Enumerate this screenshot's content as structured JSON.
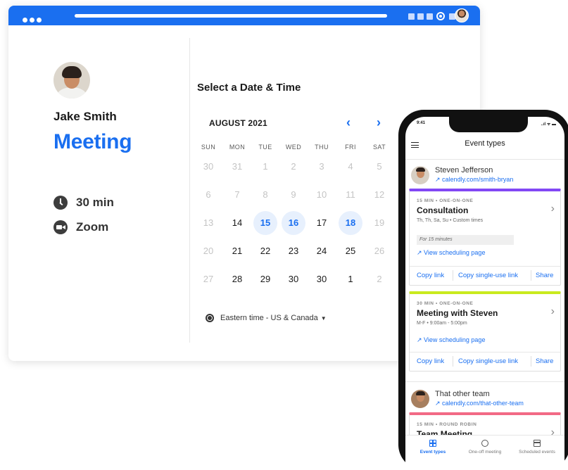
{
  "desktop": {
    "host": {
      "name": "Jake Smith"
    },
    "event": {
      "title": "Meeting",
      "duration": "30 min",
      "location": "Zoom"
    },
    "calendar": {
      "heading": "Select a Date & Time",
      "month_label": "AUGUST 2021",
      "prev_icon": "chevron-left-icon",
      "next_icon": "chevron-right-icon",
      "weekdays": [
        "SUN",
        "MON",
        "TUE",
        "WED",
        "THU",
        "FRI",
        "SAT"
      ],
      "weeks": [
        [
          {
            "d": "30",
            "s": "muted"
          },
          {
            "d": "31",
            "s": "muted"
          },
          {
            "d": "1",
            "s": "muted"
          },
          {
            "d": "2",
            "s": "muted"
          },
          {
            "d": "3",
            "s": "muted"
          },
          {
            "d": "4",
            "s": "muted"
          },
          {
            "d": "5",
            "s": "muted"
          }
        ],
        [
          {
            "d": "6",
            "s": "muted"
          },
          {
            "d": "7",
            "s": "muted"
          },
          {
            "d": "8",
            "s": "muted"
          },
          {
            "d": "9",
            "s": "muted"
          },
          {
            "d": "10",
            "s": "muted"
          },
          {
            "d": "11",
            "s": "muted"
          },
          {
            "d": "12",
            "s": "muted"
          }
        ],
        [
          {
            "d": "13",
            "s": "muted"
          },
          {
            "d": "14",
            "s": "normal"
          },
          {
            "d": "15",
            "s": "avail"
          },
          {
            "d": "16",
            "s": "avail"
          },
          {
            "d": "17",
            "s": "normal"
          },
          {
            "d": "18",
            "s": "avail"
          },
          {
            "d": "19",
            "s": "muted"
          }
        ],
        [
          {
            "d": "20",
            "s": "muted"
          },
          {
            "d": "21",
            "s": "normal"
          },
          {
            "d": "22",
            "s": "normal"
          },
          {
            "d": "23",
            "s": "normal"
          },
          {
            "d": "24",
            "s": "normal"
          },
          {
            "d": "25",
            "s": "normal"
          },
          {
            "d": "26",
            "s": "muted"
          }
        ],
        [
          {
            "d": "27",
            "s": "muted"
          },
          {
            "d": "28",
            "s": "normal"
          },
          {
            "d": "29",
            "s": "normal"
          },
          {
            "d": "30",
            "s": "normal"
          },
          {
            "d": "30",
            "s": "normal"
          },
          {
            "d": "1",
            "s": "normal"
          },
          {
            "d": "2",
            "s": "muted"
          }
        ]
      ],
      "timezone": "Eastern time - US & Canada"
    }
  },
  "phone": {
    "status_time": "9:41",
    "status_icons": "..ıl ᯤ ▬",
    "title": "Event types",
    "owners": [
      {
        "name": "Steven Jefferson",
        "link": "calendly.com/smith-bryan"
      },
      {
        "name": "That other team",
        "link": "calendly.com/that-other-team"
      }
    ],
    "cards": [
      {
        "kicker": "15 MIN • ONE-ON-ONE",
        "title": "Consultation",
        "subtitle": "Th, Th, Sa, Su • Custom times",
        "secret_note": "For 15 minutes",
        "view_link": "View scheduling page",
        "actions": [
          "Copy link",
          "Copy single-use link",
          "Share"
        ],
        "accent": "#8247f5"
      },
      {
        "kicker": "30 MIN • ONE-ON-ONE",
        "title": "Meeting with Steven",
        "subtitle": "M-F • 9:00am - 5:00pm",
        "view_link": "View scheduling page",
        "actions": [
          "Copy link",
          "Copy single-use link",
          "Share"
        ],
        "accent": "#c9ea1e"
      },
      {
        "kicker": "15 MIN • ROUND ROBIN",
        "title": "Team Meeting",
        "accent": "#f26a86"
      }
    ],
    "tabs": [
      {
        "label": "Event types",
        "icon": "grid-icon",
        "active": true
      },
      {
        "label": "One-off meeting",
        "icon": "clock-plus-icon",
        "active": false
      },
      {
        "label": "Scheduled events",
        "icon": "calendar-icon",
        "active": false
      }
    ]
  },
  "colors": {
    "brand": "#1a6ff0",
    "available_bg": "#e7f0fd",
    "muted_text": "#c4c4c4"
  }
}
